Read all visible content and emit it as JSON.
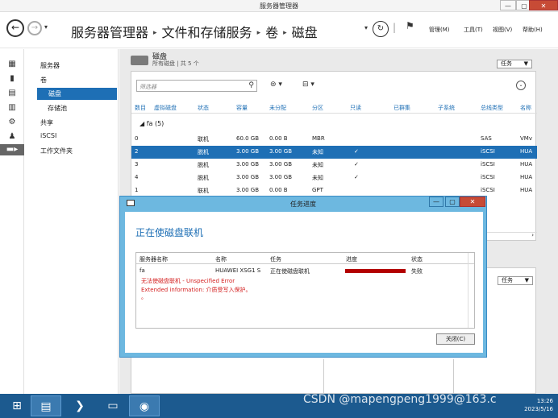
{
  "window": {
    "title": "服务器管理器",
    "minimize": "—",
    "maximize": "▢",
    "close": "✕"
  },
  "header": {
    "crumbs": [
      "服务器管理器",
      "文件和存储服务",
      "卷",
      "磁盘"
    ],
    "menu": [
      "管理(M)",
      "工具(T)",
      "视图(V)",
      "帮助(H)"
    ]
  },
  "sidebar": {
    "items": [
      "服务器",
      "卷",
      "磁盘",
      "存储池",
      "共享",
      "iSCSI",
      "工作文件夹"
    ]
  },
  "disks": {
    "title": "磁盘",
    "subtitle": "所有磁盘 | 共 5 个",
    "tasks_label": "任务",
    "filter_placeholder": "筛选器",
    "columns": [
      "数目",
      "虚拟磁盘",
      "状态",
      "容量",
      "未分配",
      "分区",
      "只读",
      "已群集",
      "子系统",
      "总线类型",
      "名称"
    ],
    "group": "fa (5)",
    "rows": [
      [
        "0",
        "",
        "联机",
        "60.0 GB",
        "0.00 B",
        "MBR",
        "",
        "",
        "",
        "SAS",
        "VMv"
      ],
      [
        "2",
        "",
        "脱机",
        "3.00 GB",
        "3.00 GB",
        "未知",
        "✓",
        "",
        "",
        "iSCSI",
        "HUA"
      ],
      [
        "3",
        "",
        "脱机",
        "3.00 GB",
        "3.00 GB",
        "未知",
        "✓",
        "",
        "",
        "iSCSI",
        "HUA"
      ],
      [
        "4",
        "",
        "脱机",
        "3.00 GB",
        "3.00 GB",
        "未知",
        "✓",
        "",
        "",
        "iSCSI",
        "HUA"
      ],
      [
        "1",
        "",
        "联机",
        "3.00 GB",
        "0.00 B",
        "GPT",
        "",
        "",
        "",
        "iSCSI",
        "HUA"
      ]
    ]
  },
  "second_panel": {
    "tasks_label": "任务"
  },
  "dialog": {
    "title": "任务进度",
    "heading": "正在使磁盘联机",
    "columns": [
      "服务器名称",
      "名称",
      "任务",
      "进度",
      "状态"
    ],
    "row": {
      "server": "fa",
      "name": "HUAWEI XSG1 S",
      "task": "正在使磁盘联机",
      "progress": 1.0,
      "status": "失败"
    },
    "errors": [
      "无法使磁盘联机 - Unspecified Error",
      "Extended information: 介质受写入保护。",
      "。"
    ],
    "close_label": "关闭(C)"
  },
  "taskbar": {
    "time": "13:26",
    "date": "2023/5/16",
    "watermark": "CSDN @mapengpeng1999@163.c"
  },
  "colors": {
    "accent": "#1e6fb5",
    "error": "#d42020",
    "progress": "#b30000",
    "taskbar": "#1c5a8f"
  }
}
